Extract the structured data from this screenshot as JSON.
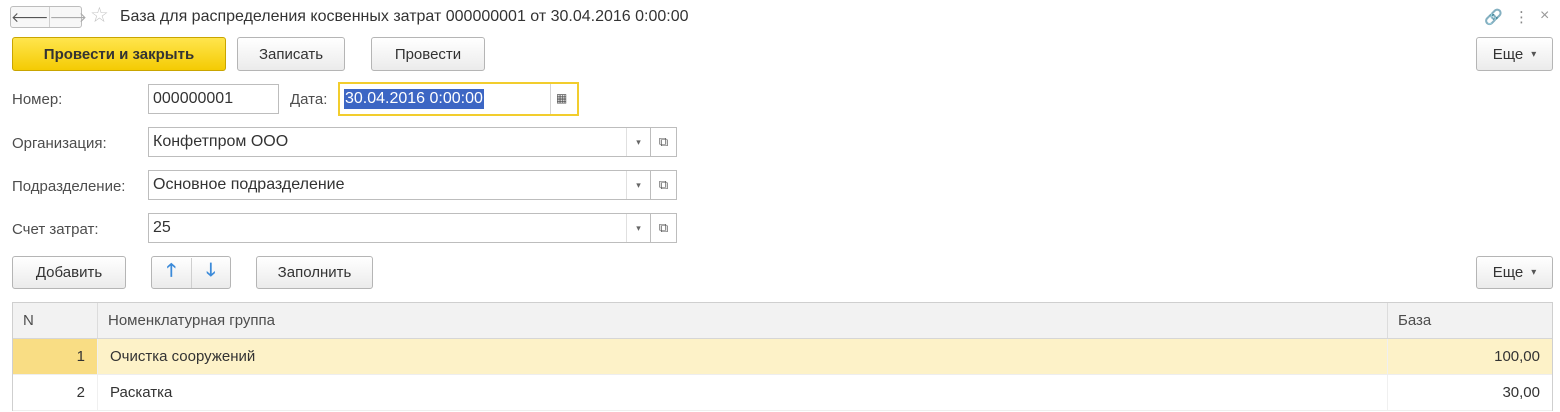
{
  "titlebar": {
    "back_glyph": "🡐",
    "forward_glyph": "🡒",
    "star_glyph": "☆",
    "title": "База для распределения косвенных затрат 000000001 от 30.04.2016 0:00:00",
    "link_glyph": "🔗",
    "more_glyph": "⋮",
    "close_glyph": "×"
  },
  "toolbar": {
    "post_and_close": "Провести и закрыть",
    "save": "Записать",
    "post": "Провести",
    "more": "Еще",
    "more_arrow": "▾"
  },
  "form": {
    "number_label": "Номер:",
    "number_value": "000000001",
    "date_label": "Дата:",
    "date_value": "30.04.2016  0:00:00",
    "calendar_glyph": "▦",
    "org_label": "Организация:",
    "org_value": "Конфетпром ООО",
    "dept_label": "Подразделение:",
    "dept_value": "Основное подразделение",
    "account_label": "Счет затрат:",
    "account_value": "25",
    "dropdown_glyph": "▾",
    "open_glyph": "⧉"
  },
  "table_toolbar": {
    "add": "Добавить",
    "up_glyph": "🡑",
    "down_glyph": "🡓",
    "fill": "Заполнить",
    "more": "Еще",
    "more_arrow": "▾"
  },
  "table": {
    "headers": [
      "N",
      "Номенклатурная группа",
      "База"
    ],
    "rows": [
      {
        "n": "1",
        "group": "Очистка сооружений",
        "base": "100,00",
        "selected": true
      },
      {
        "n": "2",
        "group": "Раскатка",
        "base": "30,00",
        "selected": false
      }
    ]
  },
  "colors": {
    "primary_button": "#f4cb03",
    "date_focus_border": "#f2cd2d",
    "selection": "#3c66c4",
    "selected_row": "#fdf2c8",
    "arrow_blue": "#3b8ad9"
  }
}
